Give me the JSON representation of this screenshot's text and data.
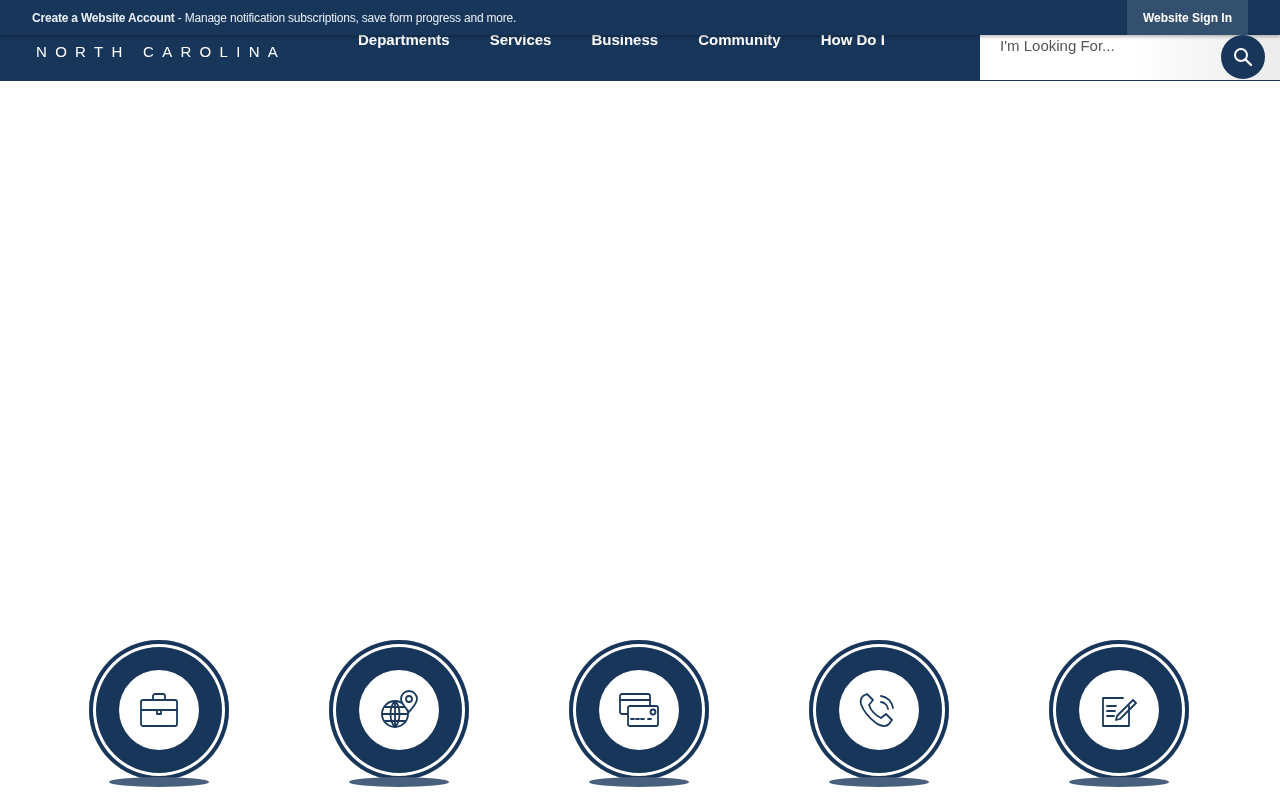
{
  "top_bar": {
    "message_bold": "Create a Website Account",
    "message": " - Manage notification subscriptions, save form progress and more.",
    "sign_in": "Website Sign In"
  },
  "logo": {
    "subtitle": "NORTH CAROLINA"
  },
  "nav": [
    "Departments",
    "Services",
    "Business",
    "Community",
    "How Do I"
  ],
  "search": {
    "placeholder": "I'm Looking For..."
  },
  "quick_links": [
    {
      "kind": "briefcase"
    },
    {
      "kind": "globe"
    },
    {
      "kind": "cards"
    },
    {
      "kind": "phone"
    },
    {
      "kind": "form"
    }
  ]
}
